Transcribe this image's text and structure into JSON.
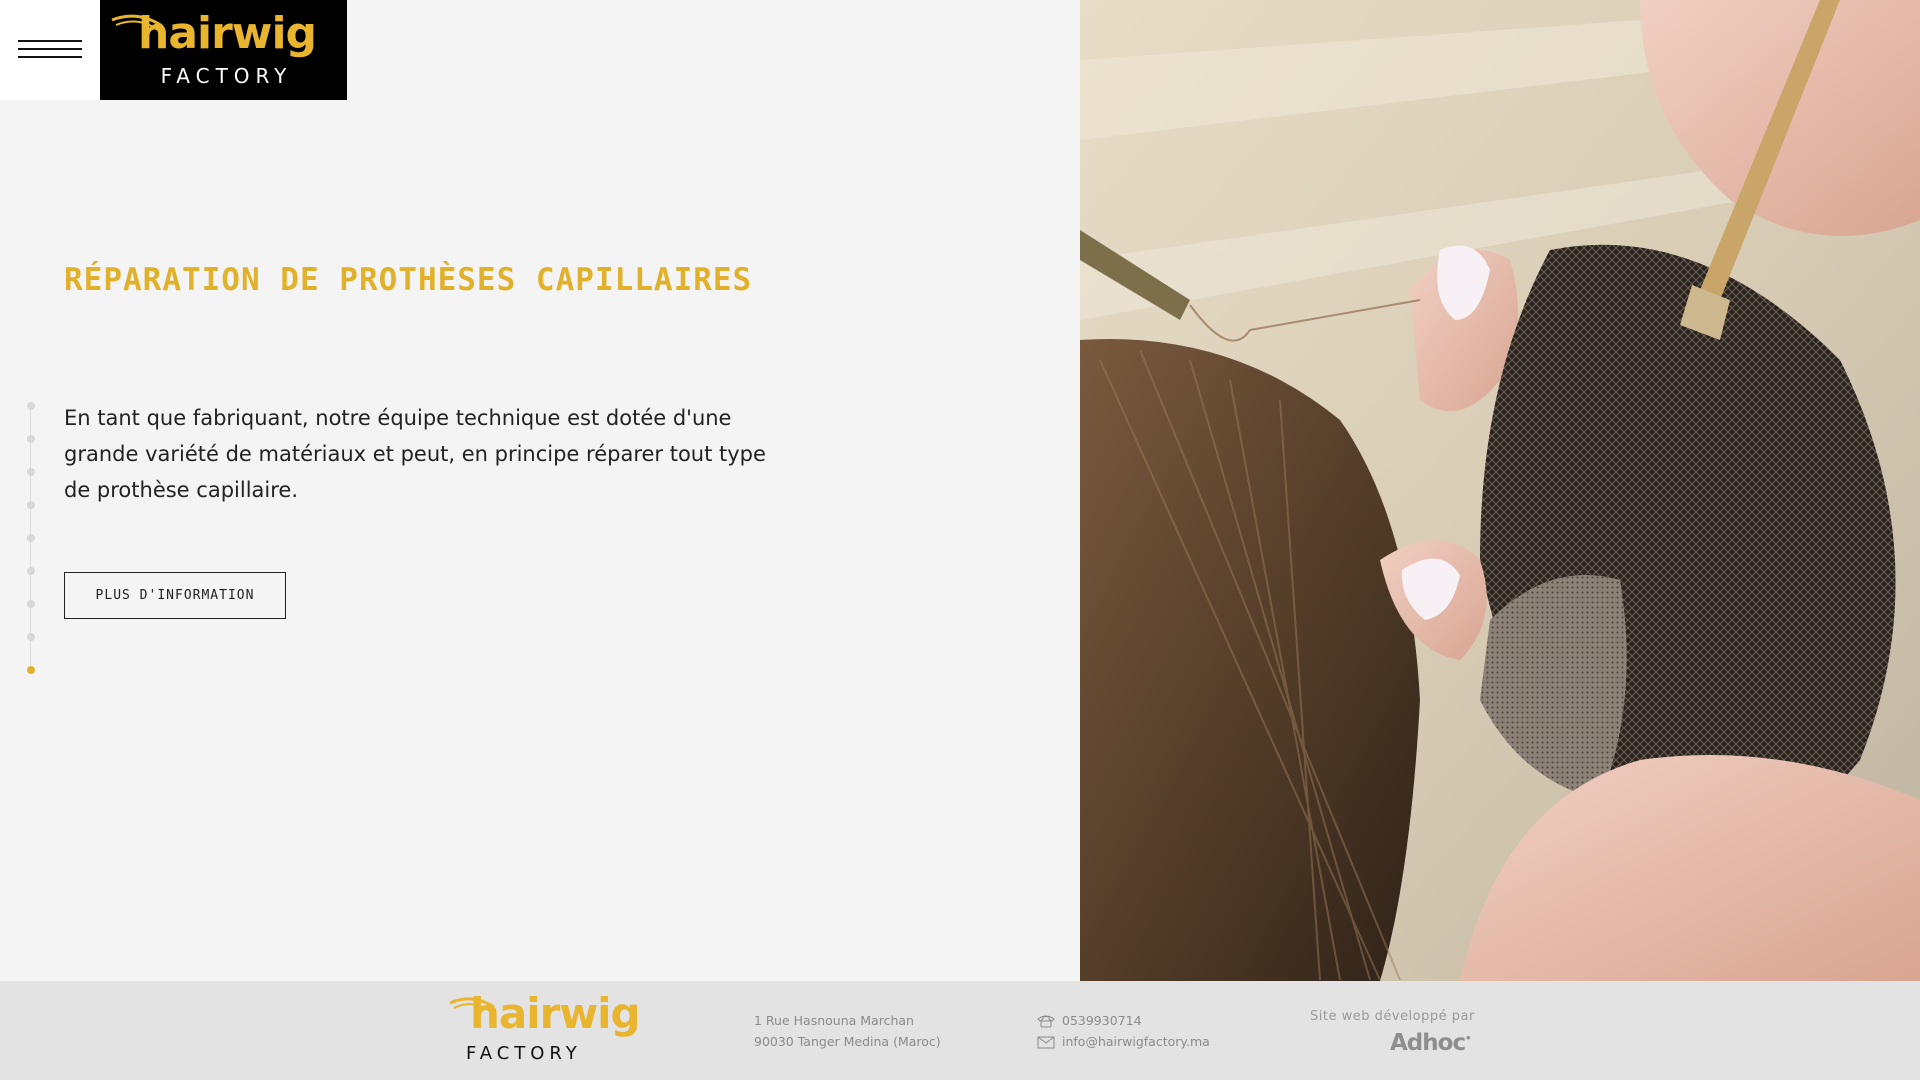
{
  "header": {
    "logo": {
      "word": "hairwig",
      "sub": "FACTORY"
    }
  },
  "slider": {
    "total": 9,
    "active": 9
  },
  "content": {
    "title": "RÉPARATION DE PROTHÈSES CAPILLAIRES",
    "body": "En tant que fabriquant, notre équipe technique est dotée d'une grande variété de matériaux et peut, en principe réparer tout type de prothèse capillaire.",
    "button_label": "PLUS D'INFORMATION"
  },
  "footer": {
    "logo": {
      "word": "hairwig",
      "sub": "FACTORY"
    },
    "address_line1": "1 Rue Hasnouna Marchan",
    "address_line2": "90030 Tanger Medina (Maroc)",
    "phone": "0539930714",
    "email": "info@hairwigfactory.ma",
    "developed_by_label": "Site web développé par",
    "developer": "Adhoc"
  },
  "colors": {
    "accent": "#e2b12c",
    "logo_gold": "#e9b42e",
    "background": "#f4f4f4",
    "footer_bg": "#e3e3e3"
  },
  "icons": [
    "menu-icon",
    "phone-icon",
    "mail-icon"
  ]
}
